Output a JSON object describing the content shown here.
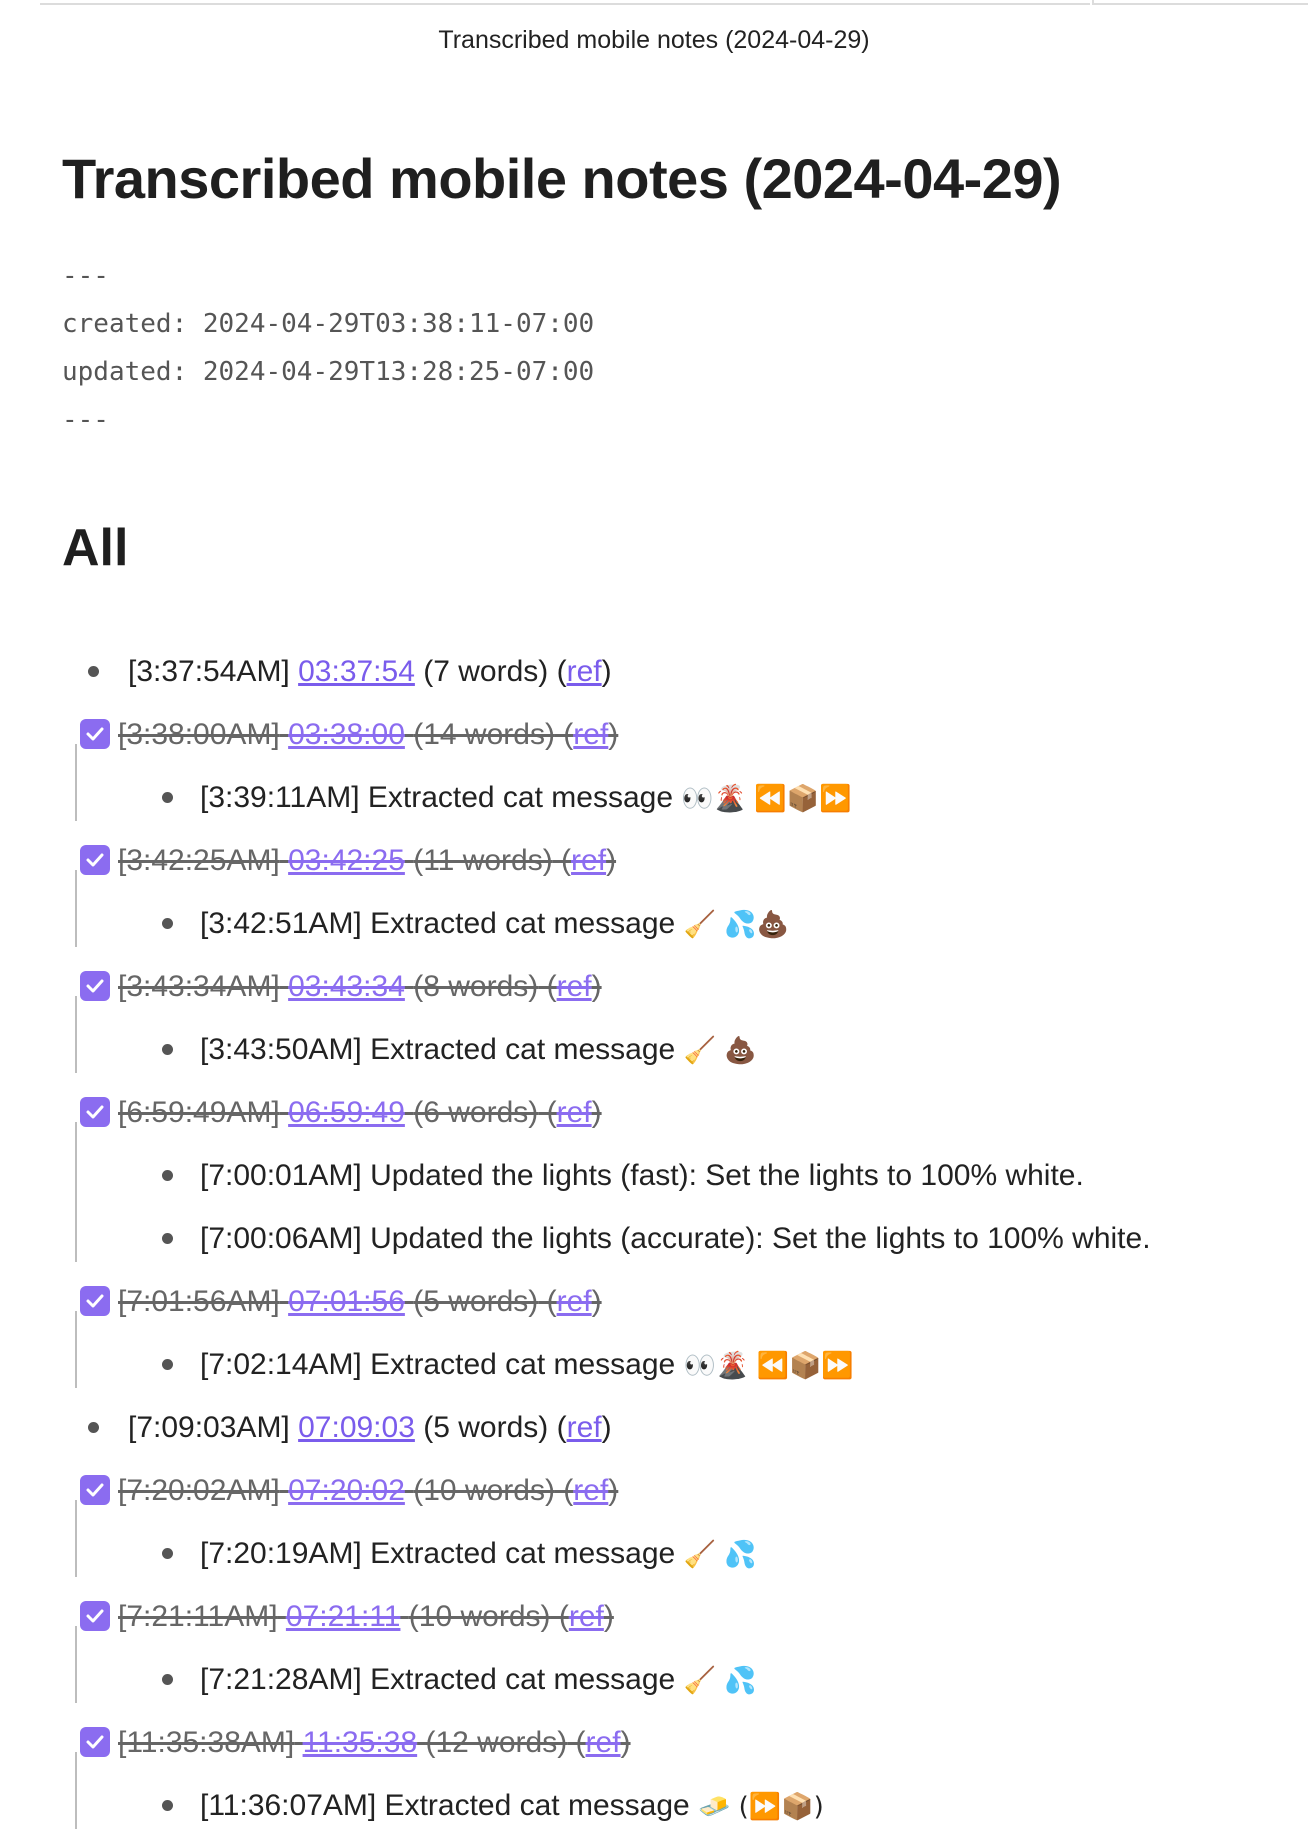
{
  "tab": {
    "title": "Transcribed mobile notes (2024-04-29)"
  },
  "note": {
    "title": "Transcribed mobile notes (2024-04-29)",
    "frontmatter": {
      "line1": "---",
      "created": "created: 2024-04-29T03:38:11-07:00",
      "updated": "updated: 2024-04-29T13:28:25-07:00",
      "line4": "---"
    },
    "section_heading": "All",
    "items": [
      {
        "time": "[3:37:54AM]",
        "link": "03:37:54",
        "words": "(7 words)",
        "ref": "ref",
        "done": false
      },
      {
        "time": "[3:38:00AM]",
        "link": "03:38:00",
        "words": "(14 words)",
        "ref": "ref",
        "done": true,
        "children": [
          {
            "text": "[3:39:11AM] Extracted cat message",
            "emoji": "👀🌋 ⏪📦⏩"
          }
        ]
      },
      {
        "time": "[3:42:25AM]",
        "link": "03:42:25",
        "words": "(11 words)",
        "ref": "ref",
        "done": true,
        "children": [
          {
            "text": "[3:42:51AM] Extracted cat message",
            "emoji": "🧹 💦💩"
          }
        ]
      },
      {
        "time": "[3:43:34AM]",
        "link": "03:43:34",
        "words": "(8 words)",
        "ref": "ref",
        "done": true,
        "children": [
          {
            "text": "[3:43:50AM] Extracted cat message",
            "emoji": "🧹 💩"
          }
        ]
      },
      {
        "time": "[6:59:49AM]",
        "link": "06:59:49",
        "words": "(6 words)",
        "ref": "ref",
        "done": true,
        "children": [
          {
            "text": "[7:00:01AM] Updated the lights (fast):  Set the lights to 100% white.",
            "emoji": ""
          },
          {
            "text": "[7:00:06AM] Updated the lights (accurate):  Set the lights to 100% white.",
            "emoji": ""
          }
        ]
      },
      {
        "time": "[7:01:56AM]",
        "link": "07:01:56",
        "words": "(5 words)",
        "ref": "ref",
        "done": true,
        "children": [
          {
            "text": "[7:02:14AM] Extracted cat message",
            "emoji": "👀🌋 ⏪📦⏩"
          }
        ]
      },
      {
        "time": "[7:09:03AM]",
        "link": "07:09:03",
        "words": "(5 words)",
        "ref": "ref",
        "done": false
      },
      {
        "time": "[7:20:02AM]",
        "link": "07:20:02",
        "words": "(10 words)",
        "ref": "ref",
        "done": true,
        "children": [
          {
            "text": "[7:20:19AM] Extracted cat message",
            "emoji": "🧹 💦"
          }
        ]
      },
      {
        "time": "[7:21:11AM]",
        "link": "07:21:11",
        "words": "(10 words)",
        "ref": "ref",
        "done": true,
        "children": [
          {
            "text": "[7:21:28AM] Extracted cat message",
            "emoji": "🧹 💦"
          }
        ]
      },
      {
        "time": "[11:35:38AM]",
        "link": "11:35:38",
        "words": "(12 words)",
        "ref": "ref",
        "done": true,
        "children": [
          {
            "text": "[11:36:07AM] Extracted cat message",
            "emoji": "🧈 (⏩📦)"
          }
        ]
      }
    ]
  },
  "colors": {
    "accent": "#8b6cf0",
    "link": "#7a5cec",
    "text": "#222222",
    "muted": "#666666"
  }
}
